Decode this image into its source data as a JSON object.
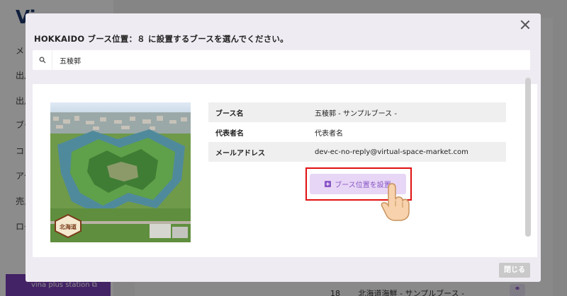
{
  "background": {
    "logo": "Vi",
    "nav_items": [
      "メ",
      "出月",
      "出月",
      "ブー",
      "コン",
      "アク",
      "売上",
      "ログ"
    ],
    "bottom_button": "vina plus station ⧉",
    "table_row": {
      "number": "18",
      "name": "北海道海鮮 - サンプルブース -"
    }
  },
  "modal": {
    "title": "HOKKAIDO ブース位置：８ に設置するブースを選んでください。",
    "search": {
      "value": "五稜郭",
      "placeholder": ""
    },
    "booth": {
      "badge_text": "北海道",
      "rows": [
        {
          "label": "ブース名",
          "value": "五稜郭 - サンプルブース -"
        },
        {
          "label": "代表者名",
          "value": "代表者名"
        },
        {
          "label": "メールアドレス",
          "value": "dev-ec-no-reply@virtual-space-market.com"
        }
      ],
      "place_button": "ブース位置を設置"
    },
    "footer_close": "閉じる"
  },
  "colors": {
    "accent": "#8a57c7",
    "button_bg": "#e7d6f5",
    "highlight": "#e01010"
  }
}
